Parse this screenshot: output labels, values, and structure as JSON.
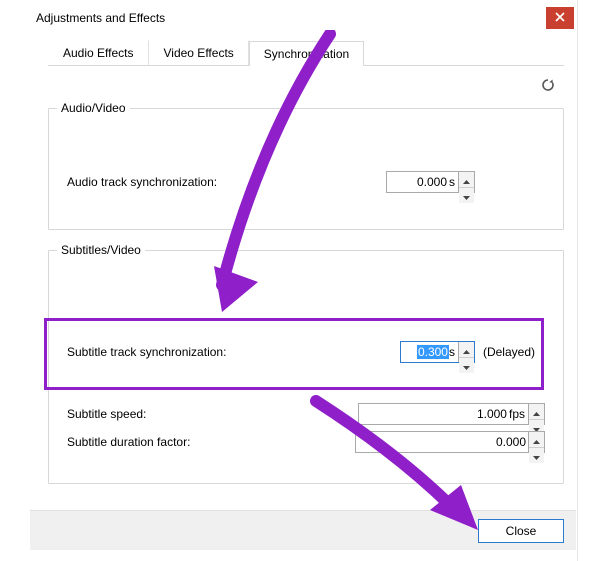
{
  "title": "Adjustments and Effects",
  "tabs": {
    "audio": "Audio Effects",
    "video": "Video Effects",
    "sync": "Synchronization"
  },
  "icons": {
    "close": "close-icon",
    "refresh": "refresh-icon",
    "chevron_up": "chevron-up-icon",
    "chevron_down": "chevron-down-icon"
  },
  "groups": {
    "av": {
      "legend": "Audio/Video",
      "audio_sync_label": "Audio track synchronization:",
      "audio_sync_value": "0.000",
      "audio_sync_unit": "s"
    },
    "sub": {
      "legend": "Subtitles/Video",
      "sub_sync_label": "Subtitle track synchronization:",
      "sub_sync_value_prefix": "",
      "sub_sync_value_sel": "0.300",
      "sub_sync_unit": "s",
      "sub_sync_status": "(Delayed)",
      "sub_speed_label": "Subtitle speed:",
      "sub_speed_value": "1.000",
      "sub_speed_unit": "fps",
      "sub_dur_label": "Subtitle duration factor:",
      "sub_dur_value": "0.000",
      "sub_dur_unit": ""
    }
  },
  "buttons": {
    "close": "Close"
  },
  "colors": {
    "annotation": "#8e1fc9",
    "close_btn": "#c94030",
    "button_border": "#2a7bd0",
    "selection": "#3399ff"
  }
}
